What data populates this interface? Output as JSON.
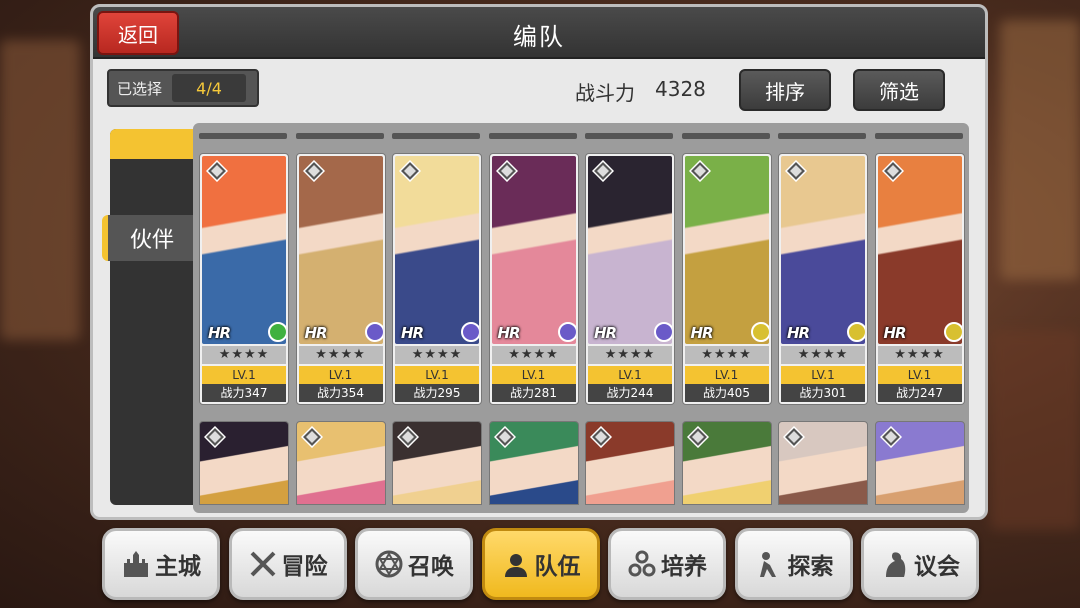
{
  "header": {
    "title": "编队",
    "back_label": "返回"
  },
  "toolbar": {
    "selected_label": "已选择",
    "selected_count": "4/4",
    "power_label": "战斗力",
    "power_value": "4328",
    "sort_label": "排序",
    "filter_label": "筛选"
  },
  "side_tabs": [
    {
      "label": "伙伴"
    }
  ],
  "cards": [
    {
      "stars": "★★★★",
      "level": "LV.1",
      "power": "战力347",
      "hr": "HR",
      "colors": [
        "#f07040",
        "#3a6aa8"
      ],
      "class_color": "#3fb13f"
    },
    {
      "stars": "★★★★",
      "level": "LV.1",
      "power": "战力354",
      "hr": "HR",
      "colors": [
        "#a4684a",
        "#d4b070"
      ],
      "class_color": "#6a5ac8"
    },
    {
      "stars": "★★★★",
      "level": "LV.1",
      "power": "战力295",
      "hr": "HR",
      "colors": [
        "#f2dc9a",
        "#3a4a8a"
      ],
      "class_color": "#6a5ac8"
    },
    {
      "stars": "★★★★",
      "level": "LV.1",
      "power": "战力281",
      "hr": "HR",
      "colors": [
        "#6a2c58",
        "#e4889a"
      ],
      "class_color": "#6a5ac8"
    },
    {
      "stars": "★★★★",
      "level": "LV.1",
      "power": "战力244",
      "hr": "HR",
      "colors": [
        "#2a2430",
        "#c8b4d0"
      ],
      "class_color": "#6a5ac8"
    },
    {
      "stars": "★★★★",
      "level": "LV.1",
      "power": "战力405",
      "hr": "HR",
      "colors": [
        "#7ab048",
        "#c4a040"
      ],
      "class_color": "#d8c030"
    },
    {
      "stars": "★★★★",
      "level": "LV.1",
      "power": "战力301",
      "hr": "HR",
      "colors": [
        "#e8c890",
        "#4a4a9a"
      ],
      "class_color": "#d8c030"
    },
    {
      "stars": "★★★★",
      "level": "LV.1",
      "power": "战力247",
      "hr": "HR",
      "colors": [
        "#e88040",
        "#8a3a2a"
      ],
      "class_color": "#d8c030"
    }
  ],
  "cards_row2": [
    {
      "colors": [
        "#2a2030",
        "#d4a040"
      ]
    },
    {
      "colors": [
        "#e8c070",
        "#e07090"
      ]
    },
    {
      "colors": [
        "#3a3030",
        "#f0d090"
      ]
    },
    {
      "colors": [
        "#3a8a5a",
        "#2a4a8a"
      ]
    },
    {
      "colors": [
        "#8a3a2a",
        "#f0a090"
      ]
    },
    {
      "colors": [
        "#4a7a3a",
        "#f0d070"
      ]
    },
    {
      "colors": [
        "#d8c8c0",
        "#8a5a4a"
      ]
    },
    {
      "colors": [
        "#8a7ad0",
        "#d8a070"
      ]
    }
  ],
  "bottom_nav": [
    {
      "label": "主城",
      "icon": "castle-icon",
      "active": false
    },
    {
      "label": "冒险",
      "icon": "crossed-swords-icon",
      "active": false
    },
    {
      "label": "召唤",
      "icon": "summon-circle-icon",
      "active": false
    },
    {
      "label": "队伍",
      "icon": "team-icon",
      "active": true
    },
    {
      "label": "培养",
      "icon": "train-icon",
      "active": false
    },
    {
      "label": "探索",
      "icon": "explore-icon",
      "active": false
    },
    {
      "label": "议会",
      "icon": "council-icon",
      "active": false
    }
  ]
}
